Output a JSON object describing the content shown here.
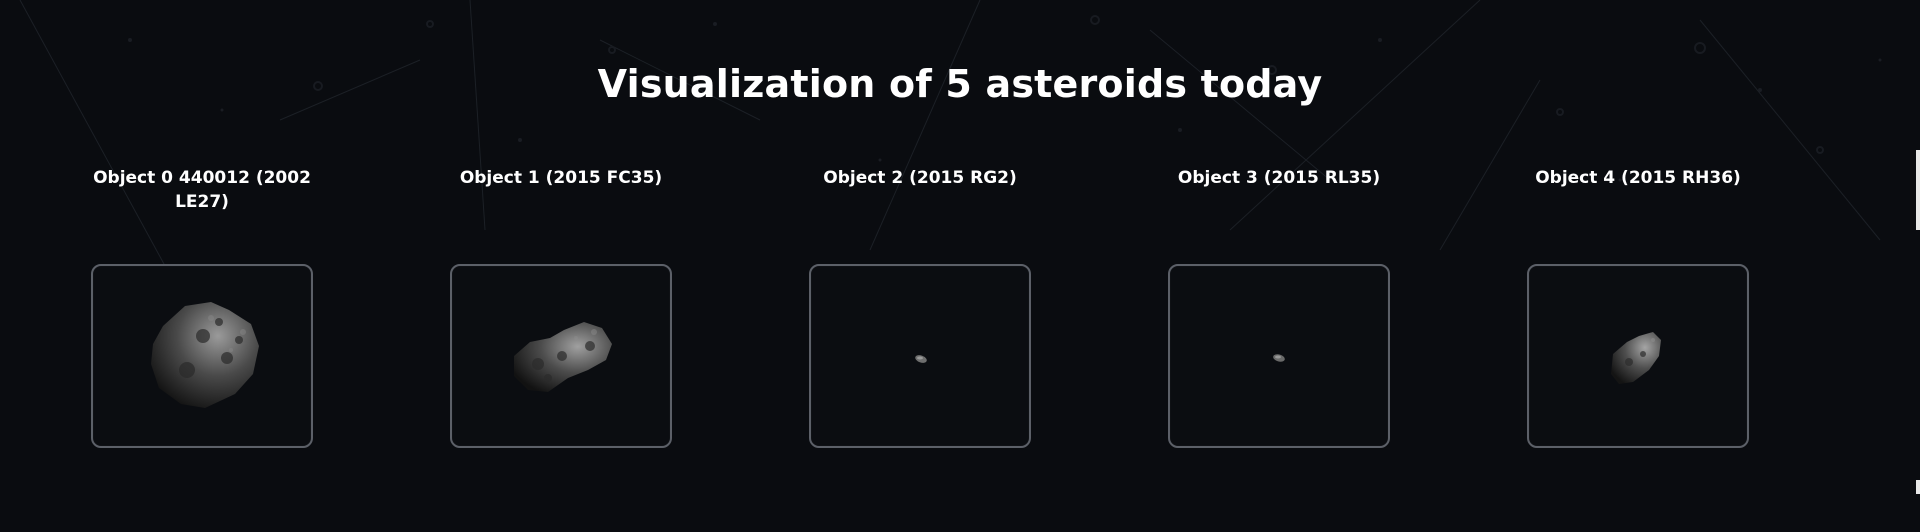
{
  "page": {
    "title": "Visualization of 5 asteroids today"
  },
  "asteroids": [
    {
      "name": "Object 0 440012 (2002 LE27)",
      "size": "large"
    },
    {
      "name": "Object 1 (2015 FC35)",
      "size": "medium"
    },
    {
      "name": "Object 2 (2015 RG2)",
      "size": "tiny"
    },
    {
      "name": "Object 3 (2015 RL35)",
      "size": "tiny"
    },
    {
      "name": "Object 4 (2015 RH36)",
      "size": "small"
    }
  ],
  "colors": {
    "background": "#0a0c10",
    "frame_border": "#5c6068",
    "text": "#ffffff",
    "rock": "#6a6a6a"
  }
}
